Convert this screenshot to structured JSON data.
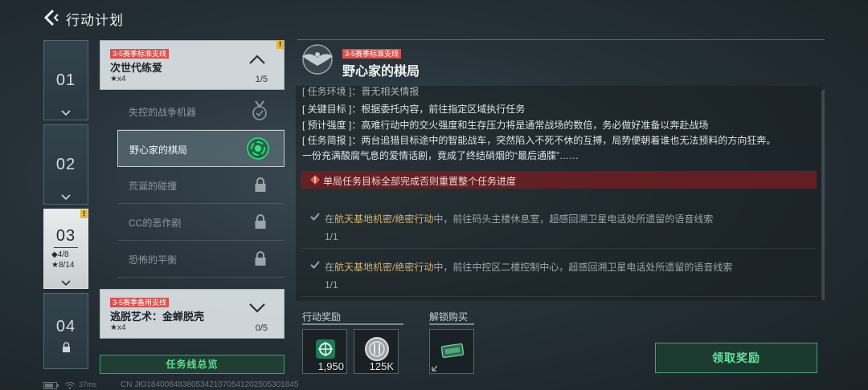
{
  "header": {
    "title": "行动计划"
  },
  "chapters": [
    {
      "num": "01"
    },
    {
      "num": "02"
    },
    {
      "num": "03",
      "badge": "!",
      "stat_diamond": "◆4/8",
      "stat_star": "★8/14"
    },
    {
      "num": "04"
    }
  ],
  "missions": [
    {
      "tag": "3-5赛季标准支线",
      "title": "次世代练爱",
      "stars": "★x4",
      "progress": "1/5",
      "badge": "!"
    },
    {
      "tag": "3-5赛季备用支线",
      "title": "逃脱艺术：金蝉脱壳",
      "stars": "★x4",
      "progress": "0/5"
    }
  ],
  "sub_missions": [
    {
      "label": "失控的战争机器",
      "icon": "medal-check-icon"
    },
    {
      "label": "野心家的棋局",
      "icon": "target-icon"
    },
    {
      "label": "荒诞的碰撞",
      "icon": "lock-icon"
    },
    {
      "label": "CC的恶作剧",
      "icon": "lock-icon"
    },
    {
      "label": "恐怖的平衡",
      "icon": "lock-icon"
    }
  ],
  "overview_button": "任务线总览",
  "detail": {
    "tag": "3-5赛季标准支线",
    "title": "野心家的棋局",
    "lines": [
      "[ 任务环境 ]：晋无相关情报",
      "[ 关键目标 ]：根据委托内容，前往指定区域执行任务",
      "[ 预计强度 ]：高难行动中的交火强度和生存压力将是通常战场的数倍，务必做好准备以奔赴战场",
      "[ 任务简报 ]：两台追猎目标途中的智能战车，突然陷入不死不休的互搏，局势便朝着谁也无法预料的方向狂奔。",
      "一份充满酸腐气息的爱情话剧，竟成了终结硝烟的“最后通牒”……"
    ],
    "warning": "单局任务目标全部完成否则重置整个任务进度",
    "objectives": [
      {
        "prefix": "在",
        "highlight": "航天基地机密/绝密行动",
        "suffix": "中，前往码头主楼休息室，超感回溯卫星电话处所遗留的语音线索",
        "count": "1/1"
      },
      {
        "prefix": "在",
        "highlight": "航天基地机密/绝密行动",
        "suffix": "中，前往中控区二楼控制中心，超感回溯卫星电话处所遗留的语音线索",
        "count": "1/1"
      }
    ]
  },
  "rewards": {
    "label": "行动奖励",
    "items": [
      {
        "icon": "green-badge-icon",
        "count": "1,950"
      },
      {
        "icon": "silver-coin-icon",
        "count": "125K"
      }
    ]
  },
  "unlock": {
    "label": "解锁购买",
    "items": [
      {
        "icon": "green-card-icon"
      }
    ]
  },
  "claim_button": "领取奖励",
  "footer": {
    "ping": "37ms",
    "text": "CN ЈЮ1840084838053421070541202505301845"
  }
}
